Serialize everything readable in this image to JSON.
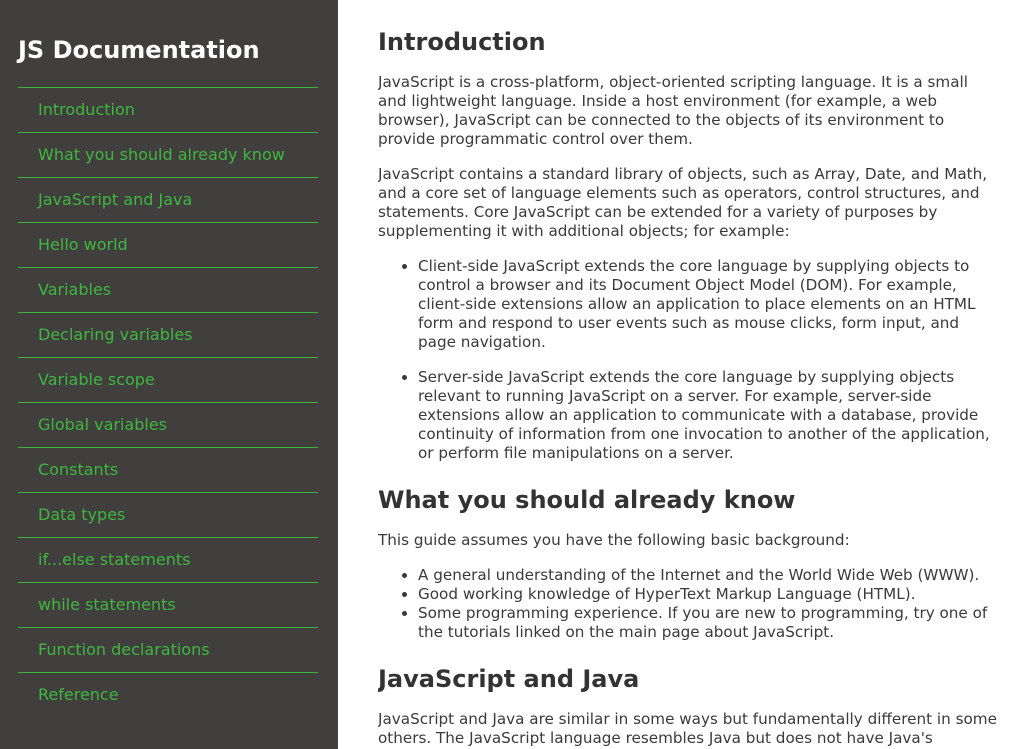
{
  "navbar": {
    "title": "JS Documentation",
    "links": [
      "Introduction",
      "What you should already know",
      "JavaScript and Java",
      "Hello world",
      "Variables",
      "Declaring variables",
      "Variable scope",
      "Global variables",
      "Constants",
      "Data types",
      "if...else statements",
      "while statements",
      "Function declarations",
      "Reference"
    ]
  },
  "sections": {
    "introduction": {
      "title": "Introduction",
      "paragraphs": [
        "JavaScript is a cross-platform, object-oriented scripting language. It is a small and lightweight language. Inside a host environment (for example, a web browser), JavaScript can be connected to the objects of its environment to provide programmatic control over them.",
        "JavaScript contains a standard library of objects, such as Array, Date, and Math, and a core set of language elements such as operators, control structures, and statements. Core JavaScript can be extended for a variety of purposes by supplementing it with additional objects; for example:"
      ],
      "bullets": [
        "Client-side JavaScript extends the core language by supplying objects to control a browser and its Document Object Model (DOM). For example, client-side extensions allow an application to place elements on an HTML form and respond to user events such as mouse clicks, form input, and page navigation.",
        "Server-side JavaScript extends the core language by supplying objects relevant to running JavaScript on a server. For example, server-side extensions allow an application to communicate with a database, provide continuity of information from one invocation to another of the application, or perform file manipulations on a server."
      ]
    },
    "already_know": {
      "title": "What you should already know",
      "paragraph": "This guide assumes you have the following basic background:",
      "bullets": [
        "A general understanding of the Internet and the World Wide Web (WWW).",
        "Good working knowledge of HyperText Markup Language (HTML).",
        "Some programming experience. If you are new to programming, try one of the tutorials linked on the main page about JavaScript."
      ]
    },
    "js_and_java": {
      "title": "JavaScript and Java",
      "paragraph": "JavaScript and Java are similar in some ways but fundamentally different in some others. The JavaScript language resembles Java but does not have Java's"
    }
  },
  "colors": {
    "sidebar_bg": "#413f3d",
    "link_green": "#3fb63f",
    "divider_green": "#3db53d",
    "heading": "#333333",
    "body_text": "#3a3a3a"
  }
}
